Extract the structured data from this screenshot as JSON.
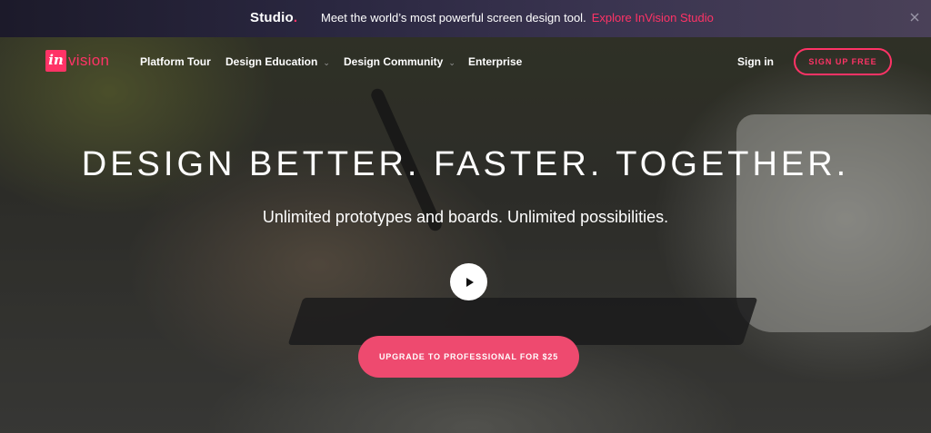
{
  "announcement": {
    "brand": "Studio",
    "brand_dot": ".",
    "message": "Meet the world’s most powerful screen design tool.",
    "link_label": "Explore InVision Studio",
    "close_icon": "close-icon"
  },
  "logo": {
    "mark": "in",
    "wordmark": "vision"
  },
  "nav": {
    "items": [
      {
        "label": "Platform Tour",
        "has_dropdown": false
      },
      {
        "label": "Design Education",
        "has_dropdown": true
      },
      {
        "label": "Design Community",
        "has_dropdown": true
      },
      {
        "label": "Enterprise",
        "has_dropdown": false
      }
    ],
    "dropdown_icon": "⌄",
    "sign_in": "Sign in",
    "sign_up": "SIGN UP FREE"
  },
  "hero": {
    "headline": "DESIGN BETTER. FASTER. TOGETHER.",
    "subheadline": "Unlimited prototypes and boards. Unlimited possibilities.",
    "play_icon": "play-icon",
    "cta": "UPGRADE TO PROFESSIONAL FOR $25"
  },
  "colors": {
    "brand_pink": "#ff3366",
    "cta_pink": "#ee4a6f",
    "text_white": "#ffffff"
  }
}
